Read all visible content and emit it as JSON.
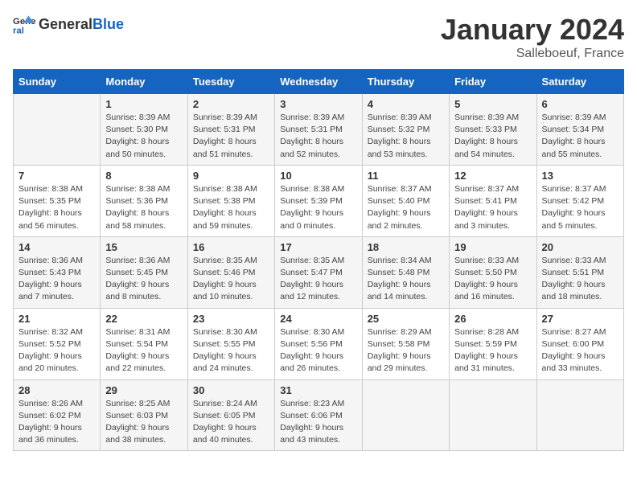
{
  "logo": {
    "text_general": "General",
    "text_blue": "Blue"
  },
  "header": {
    "month": "January 2024",
    "location": "Salleboeuf, France"
  },
  "weekdays": [
    "Sunday",
    "Monday",
    "Tuesday",
    "Wednesday",
    "Thursday",
    "Friday",
    "Saturday"
  ],
  "weeks": [
    [
      {
        "day": "",
        "sunrise": "",
        "sunset": "",
        "daylight": ""
      },
      {
        "day": "1",
        "sunrise": "Sunrise: 8:39 AM",
        "sunset": "Sunset: 5:30 PM",
        "daylight": "Daylight: 8 hours and 50 minutes."
      },
      {
        "day": "2",
        "sunrise": "Sunrise: 8:39 AM",
        "sunset": "Sunset: 5:31 PM",
        "daylight": "Daylight: 8 hours and 51 minutes."
      },
      {
        "day": "3",
        "sunrise": "Sunrise: 8:39 AM",
        "sunset": "Sunset: 5:31 PM",
        "daylight": "Daylight: 8 hours and 52 minutes."
      },
      {
        "day": "4",
        "sunrise": "Sunrise: 8:39 AM",
        "sunset": "Sunset: 5:32 PM",
        "daylight": "Daylight: 8 hours and 53 minutes."
      },
      {
        "day": "5",
        "sunrise": "Sunrise: 8:39 AM",
        "sunset": "Sunset: 5:33 PM",
        "daylight": "Daylight: 8 hours and 54 minutes."
      },
      {
        "day": "6",
        "sunrise": "Sunrise: 8:39 AM",
        "sunset": "Sunset: 5:34 PM",
        "daylight": "Daylight: 8 hours and 55 minutes."
      }
    ],
    [
      {
        "day": "7",
        "sunrise": "Sunrise: 8:38 AM",
        "sunset": "Sunset: 5:35 PM",
        "daylight": "Daylight: 8 hours and 56 minutes."
      },
      {
        "day": "8",
        "sunrise": "Sunrise: 8:38 AM",
        "sunset": "Sunset: 5:36 PM",
        "daylight": "Daylight: 8 hours and 58 minutes."
      },
      {
        "day": "9",
        "sunrise": "Sunrise: 8:38 AM",
        "sunset": "Sunset: 5:38 PM",
        "daylight": "Daylight: 8 hours and 59 minutes."
      },
      {
        "day": "10",
        "sunrise": "Sunrise: 8:38 AM",
        "sunset": "Sunset: 5:39 PM",
        "daylight": "Daylight: 9 hours and 0 minutes."
      },
      {
        "day": "11",
        "sunrise": "Sunrise: 8:37 AM",
        "sunset": "Sunset: 5:40 PM",
        "daylight": "Daylight: 9 hours and 2 minutes."
      },
      {
        "day": "12",
        "sunrise": "Sunrise: 8:37 AM",
        "sunset": "Sunset: 5:41 PM",
        "daylight": "Daylight: 9 hours and 3 minutes."
      },
      {
        "day": "13",
        "sunrise": "Sunrise: 8:37 AM",
        "sunset": "Sunset: 5:42 PM",
        "daylight": "Daylight: 9 hours and 5 minutes."
      }
    ],
    [
      {
        "day": "14",
        "sunrise": "Sunrise: 8:36 AM",
        "sunset": "Sunset: 5:43 PM",
        "daylight": "Daylight: 9 hours and 7 minutes."
      },
      {
        "day": "15",
        "sunrise": "Sunrise: 8:36 AM",
        "sunset": "Sunset: 5:45 PM",
        "daylight": "Daylight: 9 hours and 8 minutes."
      },
      {
        "day": "16",
        "sunrise": "Sunrise: 8:35 AM",
        "sunset": "Sunset: 5:46 PM",
        "daylight": "Daylight: 9 hours and 10 minutes."
      },
      {
        "day": "17",
        "sunrise": "Sunrise: 8:35 AM",
        "sunset": "Sunset: 5:47 PM",
        "daylight": "Daylight: 9 hours and 12 minutes."
      },
      {
        "day": "18",
        "sunrise": "Sunrise: 8:34 AM",
        "sunset": "Sunset: 5:48 PM",
        "daylight": "Daylight: 9 hours and 14 minutes."
      },
      {
        "day": "19",
        "sunrise": "Sunrise: 8:33 AM",
        "sunset": "Sunset: 5:50 PM",
        "daylight": "Daylight: 9 hours and 16 minutes."
      },
      {
        "day": "20",
        "sunrise": "Sunrise: 8:33 AM",
        "sunset": "Sunset: 5:51 PM",
        "daylight": "Daylight: 9 hours and 18 minutes."
      }
    ],
    [
      {
        "day": "21",
        "sunrise": "Sunrise: 8:32 AM",
        "sunset": "Sunset: 5:52 PM",
        "daylight": "Daylight: 9 hours and 20 minutes."
      },
      {
        "day": "22",
        "sunrise": "Sunrise: 8:31 AM",
        "sunset": "Sunset: 5:54 PM",
        "daylight": "Daylight: 9 hours and 22 minutes."
      },
      {
        "day": "23",
        "sunrise": "Sunrise: 8:30 AM",
        "sunset": "Sunset: 5:55 PM",
        "daylight": "Daylight: 9 hours and 24 minutes."
      },
      {
        "day": "24",
        "sunrise": "Sunrise: 8:30 AM",
        "sunset": "Sunset: 5:56 PM",
        "daylight": "Daylight: 9 hours and 26 minutes."
      },
      {
        "day": "25",
        "sunrise": "Sunrise: 8:29 AM",
        "sunset": "Sunset: 5:58 PM",
        "daylight": "Daylight: 9 hours and 29 minutes."
      },
      {
        "day": "26",
        "sunrise": "Sunrise: 8:28 AM",
        "sunset": "Sunset: 5:59 PM",
        "daylight": "Daylight: 9 hours and 31 minutes."
      },
      {
        "day": "27",
        "sunrise": "Sunrise: 8:27 AM",
        "sunset": "Sunset: 6:00 PM",
        "daylight": "Daylight: 9 hours and 33 minutes."
      }
    ],
    [
      {
        "day": "28",
        "sunrise": "Sunrise: 8:26 AM",
        "sunset": "Sunset: 6:02 PM",
        "daylight": "Daylight: 9 hours and 36 minutes."
      },
      {
        "day": "29",
        "sunrise": "Sunrise: 8:25 AM",
        "sunset": "Sunset: 6:03 PM",
        "daylight": "Daylight: 9 hours and 38 minutes."
      },
      {
        "day": "30",
        "sunrise": "Sunrise: 8:24 AM",
        "sunset": "Sunset: 6:05 PM",
        "daylight": "Daylight: 9 hours and 40 minutes."
      },
      {
        "day": "31",
        "sunrise": "Sunrise: 8:23 AM",
        "sunset": "Sunset: 6:06 PM",
        "daylight": "Daylight: 9 hours and 43 minutes."
      },
      {
        "day": "",
        "sunrise": "",
        "sunset": "",
        "daylight": ""
      },
      {
        "day": "",
        "sunrise": "",
        "sunset": "",
        "daylight": ""
      },
      {
        "day": "",
        "sunrise": "",
        "sunset": "",
        "daylight": ""
      }
    ]
  ]
}
